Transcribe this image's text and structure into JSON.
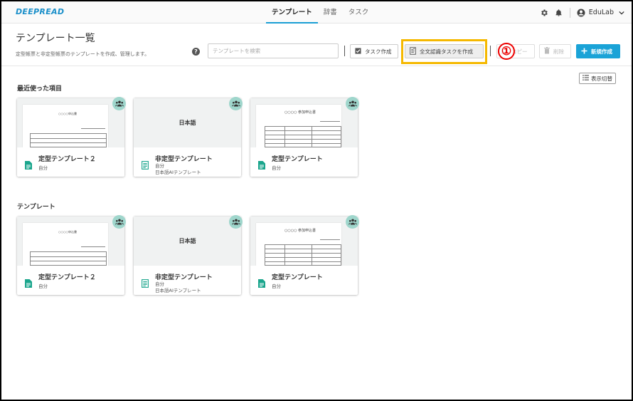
{
  "app": {
    "logo": "DEEPREAD"
  },
  "nav": {
    "tabs": [
      "テンプレート",
      "辞書",
      "タスク"
    ],
    "active": 0
  },
  "user": {
    "name": "EduLab"
  },
  "header": {
    "title": "テンプレート一覧",
    "description": "定型帳票と非定型帳票のテンプレートを作成、管理します。",
    "search_placeholder": "テンプレートを検索"
  },
  "toolbar": {
    "task_create": "タスク作成",
    "fulltext_task_create": "全文認識タスクを作成",
    "copy": "コピー",
    "delete": "削除",
    "new_create": "新規作成"
  },
  "annotation": {
    "callout": "①"
  },
  "view_toggle": "表示切替",
  "sections": [
    {
      "title": "最近使った項目",
      "cards": [
        {
          "name": "定型テンプレート２",
          "owner": "自分",
          "note": "",
          "thumb": "form-small",
          "thumb_label": "○○○○申込書"
        },
        {
          "name": "非定型テンプレート",
          "owner": "自分",
          "note": "日本語AIテンプレート",
          "thumb": "text",
          "thumb_label": "日本語"
        },
        {
          "name": "定型テンプレート",
          "owner": "自分",
          "note": "",
          "thumb": "form-table",
          "thumb_label": "○○○○ 参加申込書"
        }
      ]
    },
    {
      "title": "テンプレート",
      "cards": [
        {
          "name": "定型テンプレート２",
          "owner": "自分",
          "note": "",
          "thumb": "form-small",
          "thumb_label": "○○○○申込書"
        },
        {
          "name": "非定型テンプレート",
          "owner": "自分",
          "note": "日本語AIテンプレート",
          "thumb": "text",
          "thumb_label": "日本語"
        },
        {
          "name": "定型テンプレート",
          "owner": "自分",
          "note": "",
          "thumb": "form-table",
          "thumb_label": "○○○○ 参加申込書"
        }
      ]
    }
  ],
  "colors": {
    "accent": "#1aa3d7",
    "badge": "#9fd6cc",
    "highlight": "#f5b800",
    "callout": "#e00000",
    "file_icon": "#1aa58c"
  }
}
